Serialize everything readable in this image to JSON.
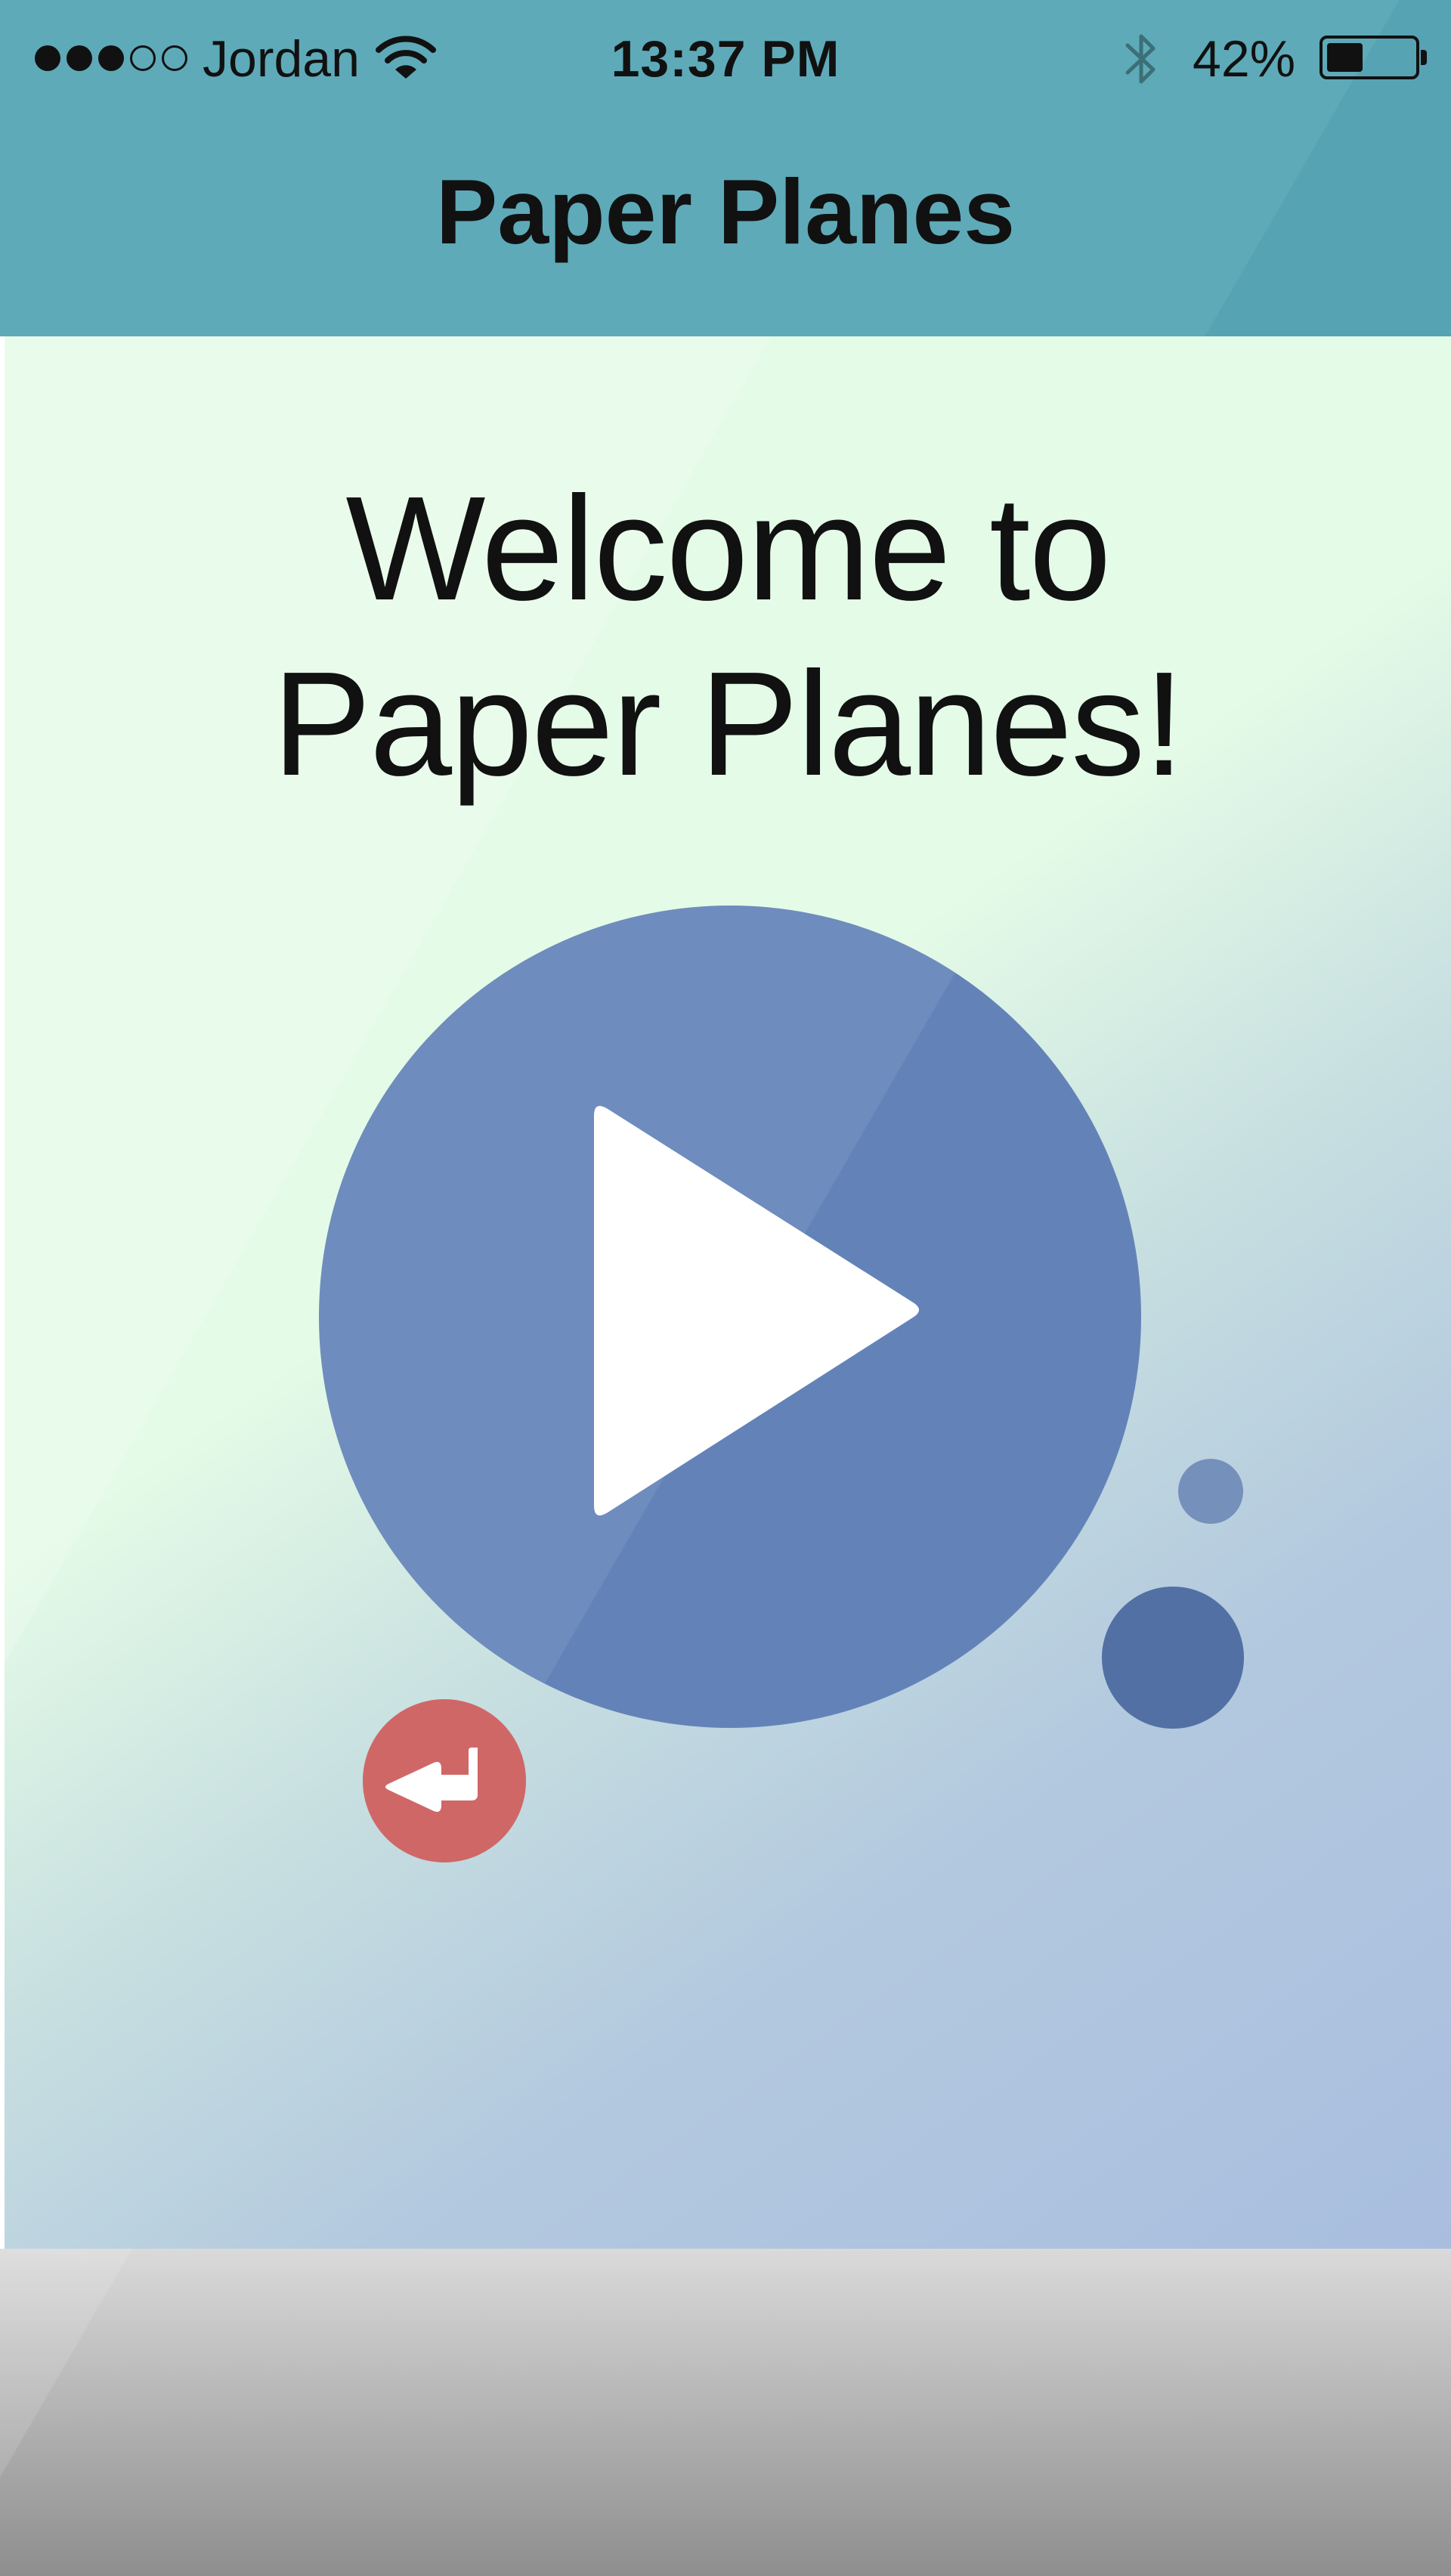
{
  "status_bar": {
    "signal": [
      true,
      true,
      true,
      false,
      false
    ],
    "carrier": "Jordan",
    "wifi_icon": "wifi-icon",
    "time": "13:37 PM",
    "bluetooth_icon": "bluetooth-icon",
    "battery_percent_label": "42%",
    "battery_level": 0.42
  },
  "nav": {
    "title": "Paper Planes"
  },
  "main": {
    "welcome_line1": "Welcome to",
    "welcome_line2": "Paper Planes!",
    "play_button_icon": "play-icon",
    "back_button_icon": "return-arrow-icon"
  },
  "colors": {
    "header": "#5eaab8",
    "play_button": "#6383b8",
    "back_button": "#d06767",
    "bubble_small": "#7590bb",
    "bubble_large": "#5270a3",
    "background_top": "#e4fbe7",
    "background_bottom": "#a9bedf"
  }
}
